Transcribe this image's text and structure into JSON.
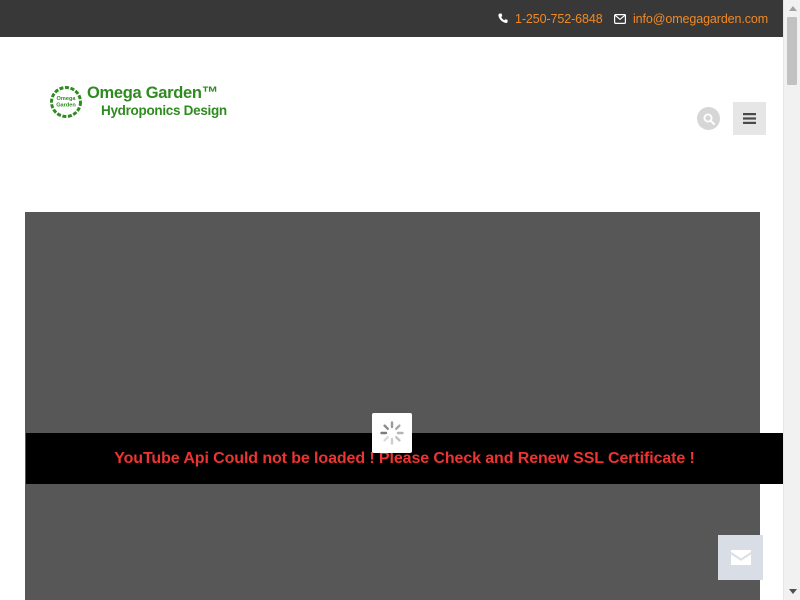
{
  "topbar": {
    "phone": "1-250-752-6848",
    "email": "info@omegagarden.com",
    "phone_icon": "phone-icon",
    "email_icon": "envelope-icon"
  },
  "logo": {
    "mark_line1": "Omega",
    "mark_line2": "Garden",
    "title": "Omega Garden™",
    "subtitle": "Hydroponics Design"
  },
  "header": {
    "search_icon": "search-icon",
    "menu_icon": "hamburger-icon"
  },
  "video": {
    "error_message": "YouTube Api Could not be loaded ! Please Check and Renew SSL Certificate !",
    "loader_icon": "spinner-icon"
  },
  "contact_float": {
    "icon": "envelope-icon"
  },
  "colors": {
    "topbar_bg": "#383838",
    "accent_orange": "#f08a24",
    "brand_green": "#2e8b1f",
    "video_bg": "#575757",
    "error_text": "#ee3333"
  }
}
